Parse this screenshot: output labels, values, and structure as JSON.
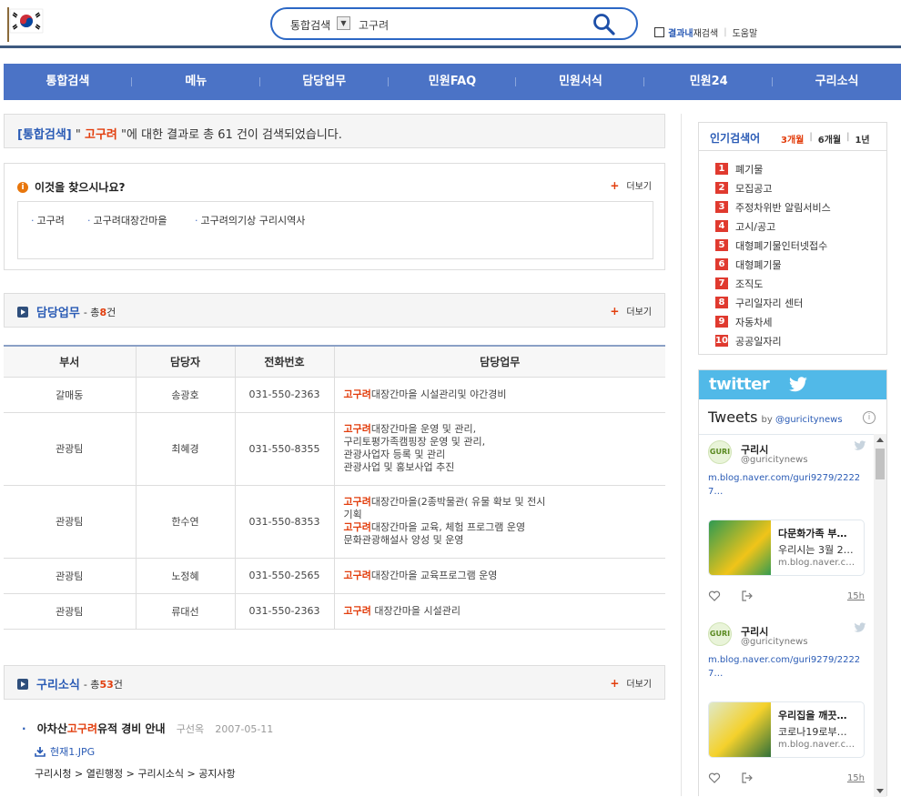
{
  "header": {
    "search_scope": "통합검색",
    "search_query": "고구려",
    "within_results": "결과내",
    "within_results_suffix": "재검색",
    "help": "도움말"
  },
  "nav": [
    "통합검색",
    "메뉴",
    "담당업무",
    "민원FAQ",
    "민원서식",
    "민원24",
    "구리소식"
  ],
  "result_summary": {
    "scope": "[통합검색]",
    "quote_open": "\"",
    "keyword": "고구려",
    "text_before_count": "\"에 대한 결과로 총",
    "count": "61",
    "text_after_count": "건이 검색되었습니다."
  },
  "suggest": {
    "title": "이것을 찾으시나요?",
    "more": "더보기",
    "keywords": [
      "고구려",
      "고구려대장간마을",
      "고구려의기상 구리시역사"
    ]
  },
  "duty_section": {
    "title": "담당업무",
    "count_prefix": "- 총",
    "count": "8",
    "count_suffix": "건",
    "more": "더보기",
    "columns": [
      "부서",
      "담당자",
      "전화번호",
      "담당업무"
    ],
    "rows": [
      {
        "dept": "갈매동",
        "person": "송광호",
        "phone": "031-550-2363",
        "duty_lines": [
          [
            "고구려",
            "대장간마을 시설관리및 야간경비"
          ]
        ]
      },
      {
        "dept": "관광팀",
        "person": "최혜경",
        "phone": "031-550-8355",
        "duty_lines": [
          [
            "고구려",
            "대장간마을 운영 및 관리,"
          ],
          [
            "",
            "구리토평가족캠핑장 운영 및 관리,"
          ],
          [
            "",
            "관광사업자 등록 및 관리"
          ],
          [
            "",
            "관광사업 및 홍보사업 추진"
          ]
        ]
      },
      {
        "dept": "관광팀",
        "person": "한수연",
        "phone": "031-550-8353",
        "duty_lines": [
          [
            "고구려",
            "대장간마을(2종박물관( 유물 확보 및 전시"
          ],
          [
            "",
            "기획"
          ],
          [
            "고구려",
            "대장간마을 교육, 체험 프로그램 운영"
          ],
          [
            "",
            "문화관광해설사 양성 및 운영"
          ]
        ]
      },
      {
        "dept": "관광팀",
        "person": "노정혜",
        "phone": "031-550-2565",
        "duty_lines": [
          [
            "고구려",
            "대장간마을 교육프로그램 운영"
          ]
        ]
      },
      {
        "dept": "관광팀",
        "person": "류대선",
        "phone": "031-550-2363",
        "duty_lines": [
          [
            "고구려",
            " 대장간마을 시설관리"
          ]
        ]
      }
    ]
  },
  "news_section": {
    "title": "구리소식",
    "count_prefix": "- 총",
    "count": "53",
    "count_suffix": "건",
    "more": "더보기",
    "items": [
      {
        "title_before": "아차산",
        "title_keyword": "고구려",
        "title_after": "유적 경비 안내",
        "author": "구선옥",
        "date": "2007-05-11",
        "attachment": "현재1.JPG",
        "path": "구리시청 > 열린행정 > 구리시소식 > 공지사항"
      }
    ]
  },
  "popular": {
    "title": "인기검색어",
    "tabs": [
      "3개월",
      "6개월",
      "1년"
    ],
    "active_tab": "3개월",
    "items": [
      "폐기물",
      "모집공고",
      "주정차위반 알림서비스",
      "고시/공고",
      "대형폐기물인터넷접수",
      "대형폐기물",
      "조직도",
      "구리일자리 센터",
      "자동차세",
      "공공일자리"
    ]
  },
  "twitter": {
    "brand": "twitter",
    "heading": "Tweets",
    "by": "by",
    "handle": "@guricitynews",
    "tweets": [
      {
        "name": "구리시",
        "handle": "@guricitynews",
        "link": "m.blog.naver.com/guri9279/22227…",
        "card_title": "다문화가족 부…",
        "card_desc": "우리시는 3월 2…",
        "card_src": "m.blog.naver.c…",
        "time": "15h"
      },
      {
        "name": "구리시",
        "handle": "@guricitynews",
        "link": "m.blog.naver.com/guri9279/22227…",
        "card_title": "우리집을 깨끗…",
        "card_desc": "코로나19로부…",
        "card_src": "m.blog.naver.c…",
        "time": "15h"
      }
    ]
  },
  "colors": {
    "nav_bg": "#4b73c6",
    "accent_red": "#e23d0c",
    "accent_blue": "#2a5bb5",
    "twitter": "#51b9e8"
  }
}
